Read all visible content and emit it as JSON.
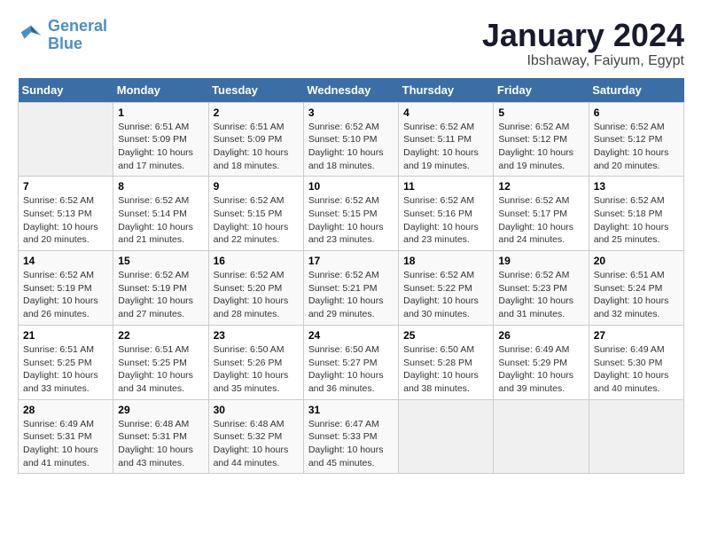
{
  "header": {
    "logo_line1": "General",
    "logo_line2": "Blue",
    "month": "January 2024",
    "location": "Ibshaway, Faiyum, Egypt"
  },
  "days_of_week": [
    "Sunday",
    "Monday",
    "Tuesday",
    "Wednesday",
    "Thursday",
    "Friday",
    "Saturday"
  ],
  "weeks": [
    [
      {
        "day": "",
        "info": ""
      },
      {
        "day": "1",
        "info": "Sunrise: 6:51 AM\nSunset: 5:09 PM\nDaylight: 10 hours\nand 17 minutes."
      },
      {
        "day": "2",
        "info": "Sunrise: 6:51 AM\nSunset: 5:09 PM\nDaylight: 10 hours\nand 18 minutes."
      },
      {
        "day": "3",
        "info": "Sunrise: 6:52 AM\nSunset: 5:10 PM\nDaylight: 10 hours\nand 18 minutes."
      },
      {
        "day": "4",
        "info": "Sunrise: 6:52 AM\nSunset: 5:11 PM\nDaylight: 10 hours\nand 19 minutes."
      },
      {
        "day": "5",
        "info": "Sunrise: 6:52 AM\nSunset: 5:12 PM\nDaylight: 10 hours\nand 19 minutes."
      },
      {
        "day": "6",
        "info": "Sunrise: 6:52 AM\nSunset: 5:12 PM\nDaylight: 10 hours\nand 20 minutes."
      }
    ],
    [
      {
        "day": "7",
        "info": "Sunrise: 6:52 AM\nSunset: 5:13 PM\nDaylight: 10 hours\nand 20 minutes."
      },
      {
        "day": "8",
        "info": "Sunrise: 6:52 AM\nSunset: 5:14 PM\nDaylight: 10 hours\nand 21 minutes."
      },
      {
        "day": "9",
        "info": "Sunrise: 6:52 AM\nSunset: 5:15 PM\nDaylight: 10 hours\nand 22 minutes."
      },
      {
        "day": "10",
        "info": "Sunrise: 6:52 AM\nSunset: 5:15 PM\nDaylight: 10 hours\nand 23 minutes."
      },
      {
        "day": "11",
        "info": "Sunrise: 6:52 AM\nSunset: 5:16 PM\nDaylight: 10 hours\nand 23 minutes."
      },
      {
        "day": "12",
        "info": "Sunrise: 6:52 AM\nSunset: 5:17 PM\nDaylight: 10 hours\nand 24 minutes."
      },
      {
        "day": "13",
        "info": "Sunrise: 6:52 AM\nSunset: 5:18 PM\nDaylight: 10 hours\nand 25 minutes."
      }
    ],
    [
      {
        "day": "14",
        "info": "Sunrise: 6:52 AM\nSunset: 5:19 PM\nDaylight: 10 hours\nand 26 minutes."
      },
      {
        "day": "15",
        "info": "Sunrise: 6:52 AM\nSunset: 5:19 PM\nDaylight: 10 hours\nand 27 minutes."
      },
      {
        "day": "16",
        "info": "Sunrise: 6:52 AM\nSunset: 5:20 PM\nDaylight: 10 hours\nand 28 minutes."
      },
      {
        "day": "17",
        "info": "Sunrise: 6:52 AM\nSunset: 5:21 PM\nDaylight: 10 hours\nand 29 minutes."
      },
      {
        "day": "18",
        "info": "Sunrise: 6:52 AM\nSunset: 5:22 PM\nDaylight: 10 hours\nand 30 minutes."
      },
      {
        "day": "19",
        "info": "Sunrise: 6:52 AM\nSunset: 5:23 PM\nDaylight: 10 hours\nand 31 minutes."
      },
      {
        "day": "20",
        "info": "Sunrise: 6:51 AM\nSunset: 5:24 PM\nDaylight: 10 hours\nand 32 minutes."
      }
    ],
    [
      {
        "day": "21",
        "info": "Sunrise: 6:51 AM\nSunset: 5:25 PM\nDaylight: 10 hours\nand 33 minutes."
      },
      {
        "day": "22",
        "info": "Sunrise: 6:51 AM\nSunset: 5:25 PM\nDaylight: 10 hours\nand 34 minutes."
      },
      {
        "day": "23",
        "info": "Sunrise: 6:50 AM\nSunset: 5:26 PM\nDaylight: 10 hours\nand 35 minutes."
      },
      {
        "day": "24",
        "info": "Sunrise: 6:50 AM\nSunset: 5:27 PM\nDaylight: 10 hours\nand 36 minutes."
      },
      {
        "day": "25",
        "info": "Sunrise: 6:50 AM\nSunset: 5:28 PM\nDaylight: 10 hours\nand 38 minutes."
      },
      {
        "day": "26",
        "info": "Sunrise: 6:49 AM\nSunset: 5:29 PM\nDaylight: 10 hours\nand 39 minutes."
      },
      {
        "day": "27",
        "info": "Sunrise: 6:49 AM\nSunset: 5:30 PM\nDaylight: 10 hours\nand 40 minutes."
      }
    ],
    [
      {
        "day": "28",
        "info": "Sunrise: 6:49 AM\nSunset: 5:31 PM\nDaylight: 10 hours\nand 41 minutes."
      },
      {
        "day": "29",
        "info": "Sunrise: 6:48 AM\nSunset: 5:31 PM\nDaylight: 10 hours\nand 43 minutes."
      },
      {
        "day": "30",
        "info": "Sunrise: 6:48 AM\nSunset: 5:32 PM\nDaylight: 10 hours\nand 44 minutes."
      },
      {
        "day": "31",
        "info": "Sunrise: 6:47 AM\nSunset: 5:33 PM\nDaylight: 10 hours\nand 45 minutes."
      },
      {
        "day": "",
        "info": ""
      },
      {
        "day": "",
        "info": ""
      },
      {
        "day": "",
        "info": ""
      }
    ]
  ]
}
